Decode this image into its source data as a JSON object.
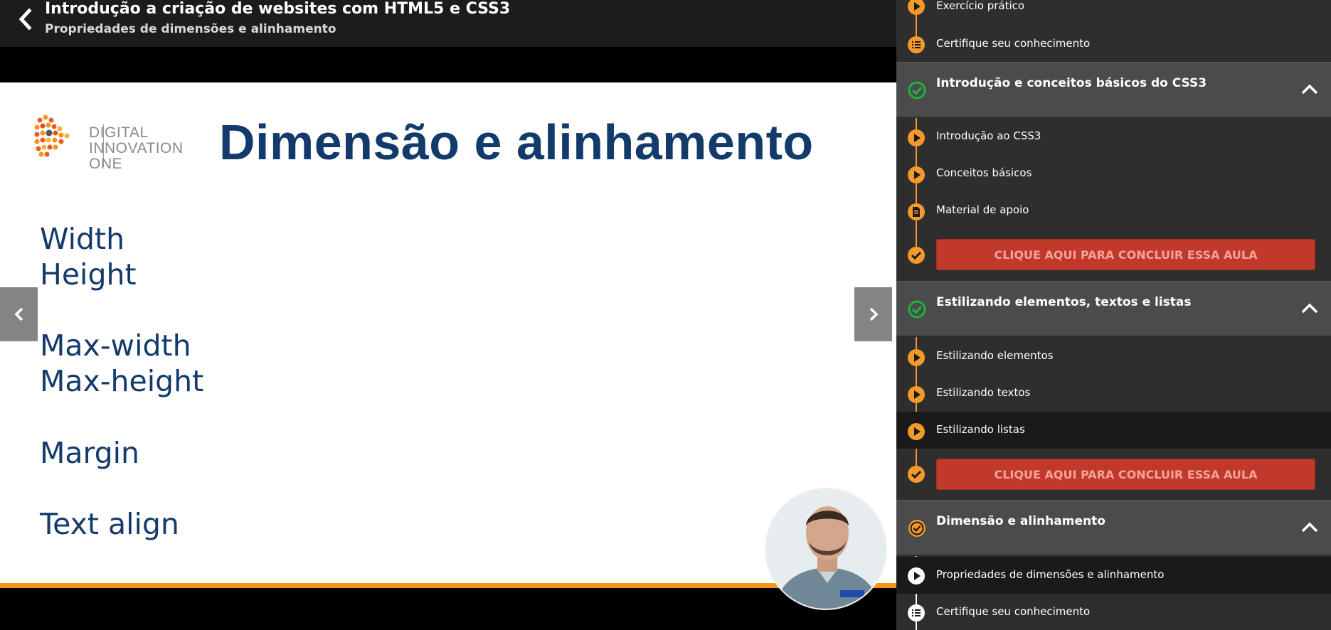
{
  "header": {
    "course_title": "Introdução a criação de websites com HTML5 e CSS3",
    "lesson_subtitle": "Propriedades de dimensões e alinhamento"
  },
  "slide": {
    "logo_lines": [
      "DIGITAL",
      "INNOVATION",
      "ONE"
    ],
    "title": "Dimensão e alinhamento",
    "properties": [
      "Width",
      "Height",
      "Max-width",
      "Max-height",
      "Margin",
      "Text align"
    ]
  },
  "sidebar": {
    "top_items": [
      {
        "label": "Exercício prático",
        "icon": "play-icon"
      },
      {
        "label": "Certifique seu conhecimento",
        "icon": "quiz-list-icon"
      }
    ],
    "sections": [
      {
        "title": "Introdução e conceitos básicos do CSS3",
        "status": "completed",
        "items": [
          {
            "label": "Introdução ao CSS3",
            "icon": "play-icon"
          },
          {
            "label": "Conceitos básicos",
            "icon": "play-icon"
          },
          {
            "label": "Material de apoio",
            "icon": "document-icon"
          }
        ],
        "conclude_label": "CLIQUE AQUI PARA CONCLUIR ESSA AULA"
      },
      {
        "title": "Estilizando elementos, textos e listas",
        "status": "completed",
        "items": [
          {
            "label": "Estilizando elementos",
            "icon": "play-icon"
          },
          {
            "label": "Estilizando textos",
            "icon": "play-icon"
          },
          {
            "label": "Estilizando listas",
            "icon": "play-icon"
          }
        ],
        "conclude_label": "CLIQUE AQUI PARA CONCLUIR ESSA AULA"
      },
      {
        "title": "Dimensão e alinhamento",
        "status": "in-progress",
        "items": [
          {
            "label": "Propriedades de dimensões e alinhamento",
            "icon": "play-icon"
          },
          {
            "label": "Certifique seu conhecimento",
            "icon": "quiz-list-icon"
          }
        ]
      }
    ]
  },
  "colors": {
    "accent_orange": "#f39a2b",
    "conclude_red": "#c0392b",
    "check_green": "#1fb141",
    "slide_title_blue": "#123a6b"
  }
}
